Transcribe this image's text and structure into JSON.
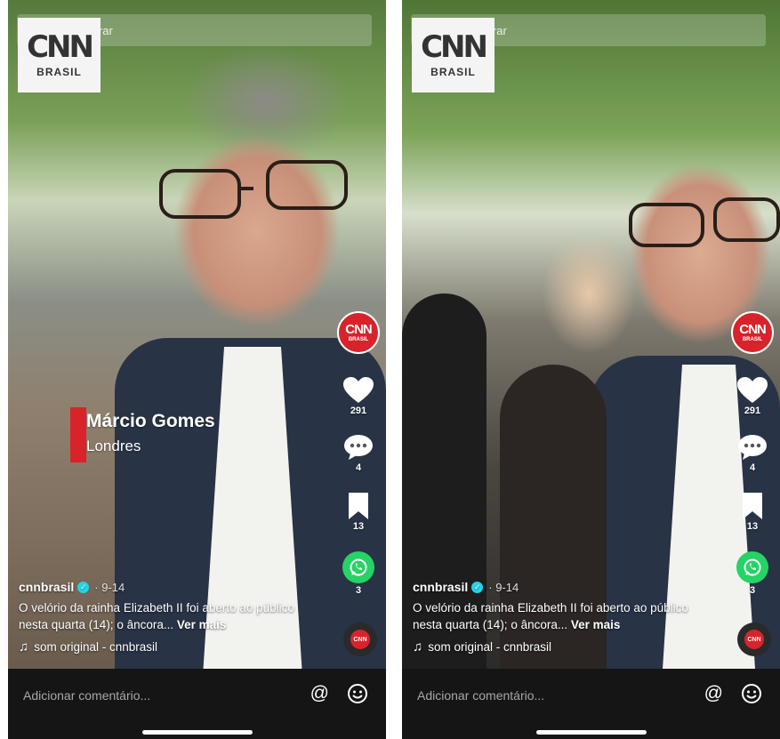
{
  "screens": [
    {
      "search_placeholder": "Procurar",
      "logo": {
        "cnn": "CNN",
        "brasil": "BRASIL"
      },
      "lower_third": {
        "name": "Márcio Gomes",
        "city": "Londres"
      },
      "avatar": {
        "cnn": "CNN",
        "brasil": "BRASIL"
      },
      "likes": "291",
      "comments": "4",
      "saves": "13",
      "shares": "3",
      "author": "cnnbrasil",
      "date": "· 9-14",
      "description": "O velório da rainha Elizabeth II foi aberto ao público nesta quarta (14); o âncora...",
      "more_label": "Ver mais",
      "music": "som original - cnnbrasil",
      "disc_label": "CNN",
      "comment_placeholder": "Adicionar comentário...",
      "at_symbol": "@"
    },
    {
      "search_placeholder": "Procurar",
      "logo": {
        "cnn": "CNN",
        "brasil": "BRASIL"
      },
      "avatar": {
        "cnn": "CNN",
        "brasil": "BRASIL"
      },
      "likes": "291",
      "comments": "4",
      "saves": "13",
      "shares": "3",
      "author": "cnnbrasil",
      "date": "· 9-14",
      "description": "O velório da rainha Elizabeth II foi aberto ao público nesta quarta (14); o âncora...",
      "more_label": "Ver mais",
      "music": "som original - cnnbrasil",
      "disc_label": "CNN",
      "comment_placeholder": "Adicionar comentário...",
      "at_symbol": "@"
    }
  ],
  "colors": {
    "brand_red": "#d8232a",
    "whatsapp_green": "#25d366",
    "verified_blue": "#20d5ec",
    "comment_bar_bg": "#151515"
  },
  "icons": [
    "back-arrow-icon",
    "search-icon",
    "heart-icon",
    "comment-icon",
    "bookmark-icon",
    "whatsapp-icon",
    "verified-icon",
    "music-note-icon",
    "at-icon",
    "emoji-icon"
  ]
}
